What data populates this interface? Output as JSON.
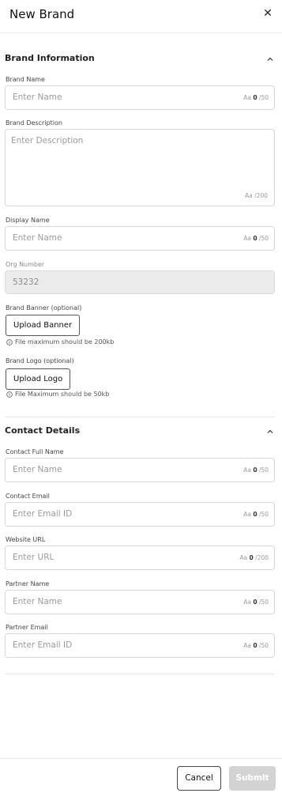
{
  "header": {
    "title": "New Brand",
    "close_icon": "close-icon"
  },
  "brand_info": {
    "section_title": "Brand Information",
    "brand_name": {
      "label": "Brand Name",
      "placeholder": "Enter Name",
      "count_prefix": "Aa",
      "count": "0",
      "max": "/50"
    },
    "brand_description": {
      "label": "Brand Description",
      "placeholder": "Enter Description",
      "counter": "Aa /200"
    },
    "display_name": {
      "label": "Display Name",
      "placeholder": "Enter Name",
      "count_prefix": "Aa",
      "count": "0",
      "max": "/50"
    },
    "org_number": {
      "label": "Org Number",
      "value": "53232"
    },
    "brand_banner": {
      "label": "Brand Banner (optional)",
      "button": "Upload Banner",
      "hint": "File maximum should be 200kb"
    },
    "brand_logo": {
      "label": "Brand Logo (optional)",
      "button": "Upload Logo",
      "hint": "File Maximum should be 50kb"
    }
  },
  "contact": {
    "section_title": "Contact Details",
    "full_name": {
      "label": "Contact Full Name",
      "placeholder": "Enter Name",
      "count_prefix": "Aa",
      "count": "0",
      "max": "/50"
    },
    "email": {
      "label": "Contact Email",
      "placeholder": "Enter Email ID",
      "count_prefix": "Aa",
      "count": "0",
      "max": "/50"
    },
    "website": {
      "label": "Website URL",
      "placeholder": "Enter URL",
      "count_prefix": "Aa",
      "count": "0",
      "max": "/200"
    },
    "partner_name": {
      "label": "Partner Name",
      "placeholder": "Enter Name",
      "count_prefix": "Aa",
      "count": "0",
      "max": "/50"
    },
    "partner_email": {
      "label": "Partner Email",
      "placeholder": "Enter Email ID",
      "count_prefix": "Aa",
      "count": "0",
      "max": "/50"
    }
  },
  "footer": {
    "cancel_label": "Cancel",
    "submit_label": "Submit"
  },
  "colors": {
    "border": "#d7d7d7",
    "readonly_bg": "#ececec",
    "submit_disabled": "#d3d3d3"
  }
}
